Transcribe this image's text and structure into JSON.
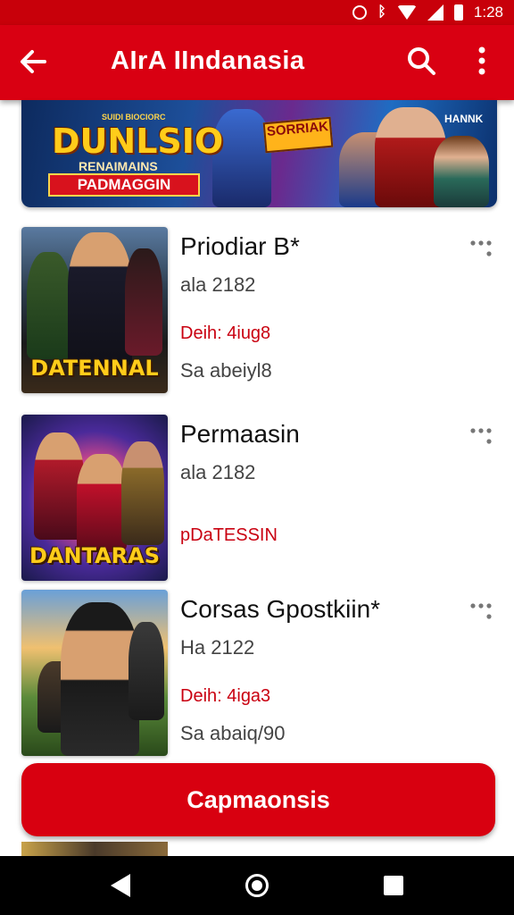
{
  "status_bar": {
    "time": "1:28",
    "icons": [
      "alarm-icon",
      "bluetooth-icon",
      "wifi-icon",
      "signal-icon",
      "battery-icon"
    ]
  },
  "app_bar": {
    "title": "AIrA IIndanasia",
    "back_icon": "arrow-back-icon",
    "search_icon": "search-icon",
    "menu_icon": "more-vertical-icon"
  },
  "banner": {
    "small_text": "SUIDI BIOCIORC",
    "title": "DUNLSIO",
    "subtitle": "RENAIMAINS",
    "ribbon": "PADMAGGIN",
    "sticker": "SORRIAK",
    "corner_label": "HANNK"
  },
  "items": [
    {
      "title": "Priodiar B*",
      "meta": "ala 2182",
      "red_text": "Deih: 4iug8",
      "footer": "Sa abeiyl8",
      "thumb_caption": "DATENNAL",
      "more_icon": "more-horizontal-icon"
    },
    {
      "title": "Permaasin",
      "meta": "ala 2182",
      "red_text": "pDaTESSIN",
      "footer": "",
      "thumb_caption": "DANTARAS",
      "more_icon": "more-horizontal-icon"
    },
    {
      "title": "Corsas Gpostkiin*",
      "meta": "Ha 2122",
      "red_text": "Deih: 4iga3",
      "footer": "Sa abaiq/90",
      "thumb_caption": "",
      "more_icon": "more-horizontal-icon"
    }
  ],
  "cta": {
    "label": "Capmaonsis"
  },
  "nav_bar": {
    "icons": [
      "nav-back-icon",
      "nav-home-icon",
      "nav-recents-icon"
    ]
  },
  "colors": {
    "primary": "#d90012",
    "status_bar": "#c8000a",
    "accent_text": "#c90010",
    "nav_bar": "#000000"
  }
}
